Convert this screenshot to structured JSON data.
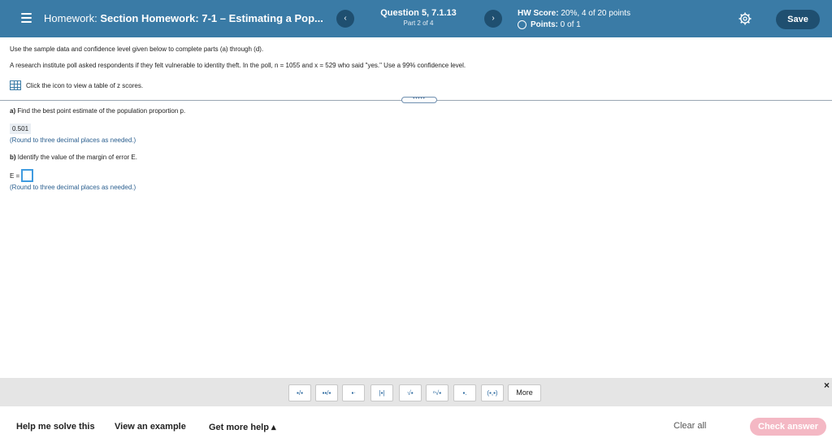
{
  "header": {
    "title_prefix": "Homework:",
    "title_main": "Section Homework: 7-1 – Estimating a Pop...",
    "prev_icon": "‹",
    "next_icon": "›",
    "question_title": "Question 5, 7.1.13",
    "question_part": "Part 2 of 4",
    "hw_score_label": "HW Score:",
    "hw_score_value": "20%, 4 of 20 points",
    "points_label": "Points:",
    "points_value": "0 of 1",
    "save_label": "Save"
  },
  "body": {
    "intro": "Use the sample data and confidence level given below to complete parts (a) through (d).",
    "problem": "A research institute poll asked respondents if they felt vulnerable to identity theft. In the poll, n = 1055 and x = 529 who said \"yes.\" Use a 99% confidence level.",
    "ztable_link": "Click the icon to view a table of z scores.",
    "divider_handle": "•••••",
    "part_a_label": "a)",
    "part_a_text": "Find the best point estimate of the population proportion p.",
    "part_a_answer": "0.501",
    "part_a_hint": "(Round to three decimal places as needed.)",
    "part_b_label": "b)",
    "part_b_text": "Identify the value of the margin of error E.",
    "e_label": "E =",
    "part_b_hint": "(Round to three decimal places as needed.)"
  },
  "toolbar": {
    "buttons": [
      "▪/▪",
      "▪▪/▪",
      "▪ᐧ",
      "|▪|",
      "√▪",
      "ⁿ√▪",
      "▪.",
      "(▪,▪)"
    ],
    "more_label": "More",
    "close_icon": "×"
  },
  "footer": {
    "help_solve": "Help me solve this",
    "view_example": "View an example",
    "get_help": "Get more help ▴",
    "clear_all": "Clear all",
    "check_answer": "Check answer"
  },
  "colors": {
    "header_bg": "#3a7ba6",
    "button_dark": "#1f4f70",
    "input_border": "#3f9be0",
    "check_answer_bg": "#f4b8c4"
  }
}
